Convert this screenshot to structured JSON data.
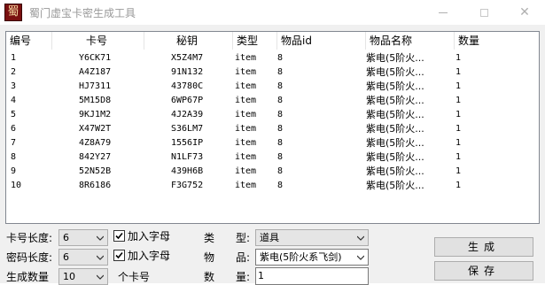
{
  "window": {
    "title": "蜀门虚宝卡密生成工具",
    "icon": "app-logo-icon"
  },
  "table": {
    "columns": [
      "编号",
      "卡号",
      "秘钥",
      "类型",
      "物品id",
      "物品名称",
      "数量"
    ],
    "rows": [
      [
        "1",
        "Y6CK71",
        "X5Z4M7",
        "item",
        "8",
        "紫电(5阶火...",
        "1"
      ],
      [
        "2",
        "A4Z187",
        "91N132",
        "item",
        "8",
        "紫电(5阶火...",
        "1"
      ],
      [
        "3",
        "HJ7311",
        "43780C",
        "item",
        "8",
        "紫电(5阶火...",
        "1"
      ],
      [
        "4",
        "5M15D8",
        "6WP67P",
        "item",
        "8",
        "紫电(5阶火...",
        "1"
      ],
      [
        "5",
        "9KJ1M2",
        "4J2A39",
        "item",
        "8",
        "紫电(5阶火...",
        "1"
      ],
      [
        "6",
        "X47W2T",
        "S36LM7",
        "item",
        "8",
        "紫电(5阶火...",
        "1"
      ],
      [
        "7",
        "4Z8A79",
        "1556IP",
        "item",
        "8",
        "紫电(5阶火...",
        "1"
      ],
      [
        "8",
        "842Y27",
        "N1LF73",
        "item",
        "8",
        "紫电(5阶火...",
        "1"
      ],
      [
        "9",
        "52N52B",
        "439H6B",
        "item",
        "8",
        "紫电(5阶火...",
        "1"
      ],
      [
        "10",
        "8R6186",
        "F3G752",
        "item",
        "8",
        "紫电(5阶火...",
        "1"
      ]
    ]
  },
  "form": {
    "card_length_label": "卡号长度:",
    "card_length_value": "6",
    "card_letters_label": "加入字母",
    "card_letters_checked": true,
    "pwd_length_label": "密码长度:",
    "pwd_length_value": "6",
    "pwd_letters_label": "加入字母",
    "pwd_letters_checked": true,
    "gen_count_label": "生成数量",
    "gen_count_value": "10",
    "gen_count_unit": "个卡号",
    "type_label_a": "类",
    "type_label_b": "型:",
    "type_value": "道具",
    "item_label_a": "物",
    "item_label_b": "品:",
    "item_value": "紫电(5阶火系飞剑)",
    "qty_label_a": "数",
    "qty_label_b": "量:",
    "qty_value": "1"
  },
  "buttons": {
    "generate": "生成",
    "save": "保存"
  }
}
